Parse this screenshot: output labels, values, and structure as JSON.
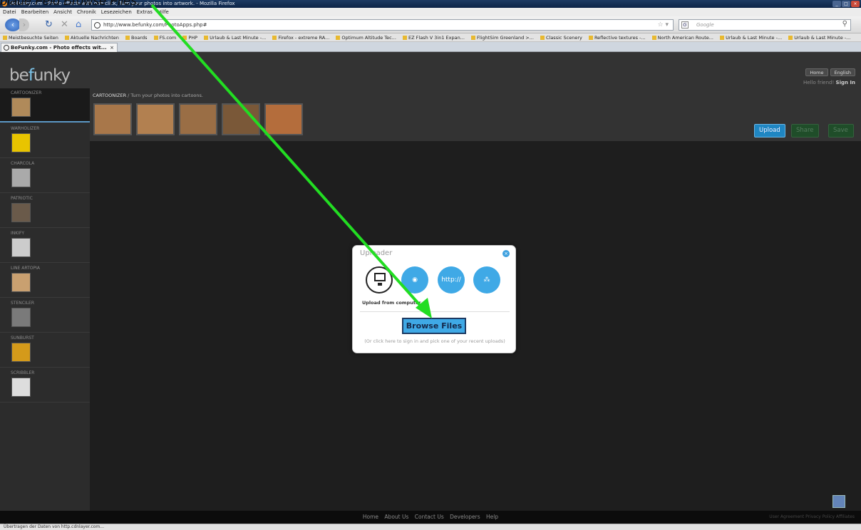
{
  "caption": "blaue Feld Browse Files.",
  "browser": {
    "title": "BeFunky.com - Photo effects with one click, Turn your photos into artwork. - Mozilla Firefox",
    "menu": [
      "Datei",
      "Bearbeiten",
      "Ansicht",
      "Chronik",
      "Lesezeichen",
      "Extras",
      "Hilfe"
    ],
    "url": "http://www.befunky.com/PhotoApps.php#",
    "search_placeholder": "Google",
    "bookmarks": [
      "Meistbesuchte Seiten",
      "Aktuelle Nachrichten",
      "Boards",
      "FS.com",
      "PHP",
      "Urlaub & Last Minute -...",
      "Firefox - extreme RA...",
      "Optimum Altitude Tec...",
      "EZ Flash V 3in1 Expan...",
      "FlightSim Greenland >...",
      "Classic Scenery",
      "Reflective textures -...",
      "North American Route...",
      "Urlaub & Last Minute -...",
      "Urlaub & Last Minute -..."
    ],
    "tab_label": "BeFunky.com - Photo effects wit...",
    "status": "Übertragen der Daten von http.cdnlayer.com..."
  },
  "site": {
    "logo_main": "be",
    "logo_accent": "f",
    "logo_rest": "unky",
    "home": "Home",
    "language": "English",
    "hello": "Hello friend!",
    "sign_in": "Sign In",
    "breadcrumb_effect": "CARTOONIZER",
    "breadcrumb_desc": " / Turn your photos into cartoons.",
    "effects": [
      "CARTOONIZER",
      "WARHOLIZER",
      "CHARCOLA",
      "PATRIOTIC",
      "INKIFY",
      "LINE ARTOPIA",
      "STENCILER",
      "SUNBURST",
      "SCRIBBLER"
    ],
    "actions": {
      "upload": "Upload",
      "share": "Share",
      "save": "Save"
    },
    "footer_links": [
      "Home",
      "About Us",
      "Contact Us",
      "Developers",
      "Help"
    ],
    "footer_right": "User Agreement   Privacy Policy   Affiliates"
  },
  "uploader": {
    "title": "Uploader",
    "source_computer_label": "Upload from computer",
    "source_web": "http://",
    "browse_button": "Browse Files",
    "hint": "(Or click here to sign in and pick one of your recent uploads)"
  },
  "colors": {
    "accent": "#3fa9e6",
    "arrow": "#22dd22"
  }
}
